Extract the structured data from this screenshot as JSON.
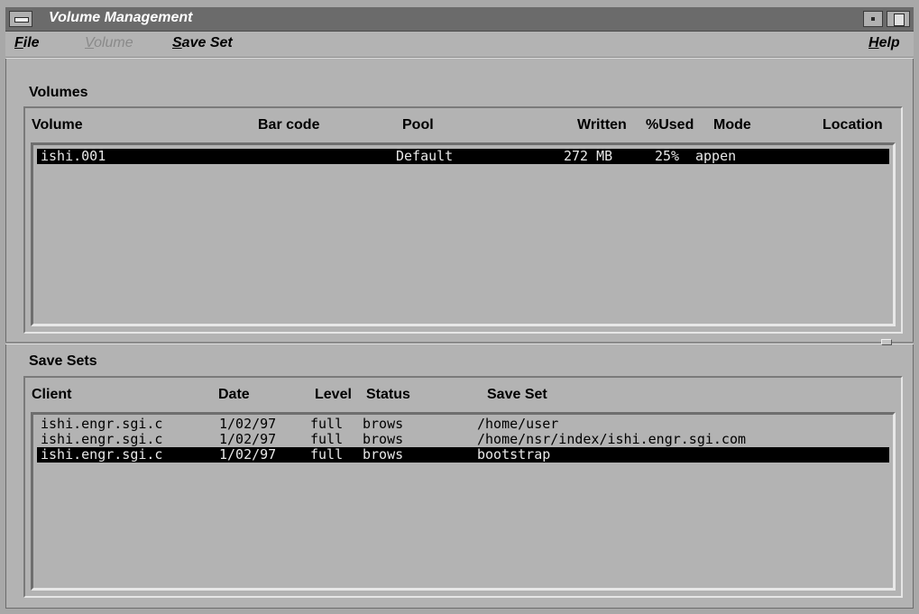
{
  "window": {
    "title": "Volume Management"
  },
  "menu": [
    {
      "mnemonic": "F",
      "rest": "ile",
      "enabled": true
    },
    {
      "mnemonic": "V",
      "rest": "olume",
      "enabled": false
    },
    {
      "mnemonic": "S",
      "rest": "ave Set",
      "enabled": true
    },
    {
      "mnemonic": "H",
      "rest": "elp",
      "enabled": true
    }
  ],
  "volumes": {
    "title": "Volumes",
    "columns": [
      "Volume",
      "Bar code",
      "Pool",
      "Written",
      "%Used",
      "Mode",
      "Location"
    ],
    "rows": [
      {
        "volume": "ishi.001",
        "barcode": "",
        "pool": "Default",
        "written": "272 MB",
        "used": "25%",
        "mode": "appen",
        "location": "",
        "selected": true
      }
    ]
  },
  "savesets": {
    "title": "Save Sets",
    "columns": [
      "Client",
      "Date",
      "Level",
      "Status",
      "Save Set"
    ],
    "rows": [
      {
        "client": "ishi.engr.sgi.c",
        "date": "1/02/97",
        "level": "full",
        "status": "brows",
        "saveset": "/home/user",
        "selected": false
      },
      {
        "client": "ishi.engr.sgi.c",
        "date": "1/02/97",
        "level": "full",
        "status": "brows",
        "saveset": "/home/nsr/index/ishi.engr.sgi.com",
        "selected": false
      },
      {
        "client": "ishi.engr.sgi.c",
        "date": "1/02/97",
        "level": "full",
        "status": "brows",
        "saveset": "bootstrap",
        "selected": true
      }
    ]
  }
}
